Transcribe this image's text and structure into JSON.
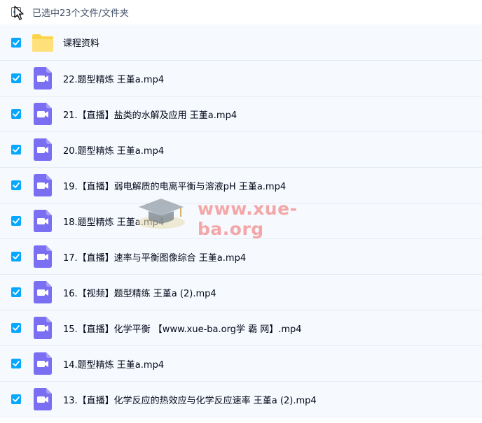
{
  "header": {
    "selection_text": "已选中23个文件/文件夹"
  },
  "colors": {
    "checkbox": "#06a7ff",
    "folder": "#fbd44b",
    "video_icon": "#7a6ef2",
    "row_bg": "#f6f9fd",
    "watermark": "#f38c8c"
  },
  "files": [
    {
      "name": "课程资料",
      "type": "folder-icon",
      "checked": true
    },
    {
      "name": "22.题型精炼 王堇a.mp4",
      "type": "video-file-icon",
      "checked": true
    },
    {
      "name": "21.【直播】盐类的水解及应用 王堇a.mp4",
      "type": "video-file-icon",
      "checked": true
    },
    {
      "name": "20.题型精炼 王堇a.mp4",
      "type": "video-file-icon",
      "checked": true
    },
    {
      "name": "19.【直播】弱电解质的电离平衡与溶液pH 王堇a.mp4",
      "type": "video-file-icon",
      "checked": true
    },
    {
      "name": "18.题型精炼 王堇a.mp4",
      "type": "video-file-icon",
      "checked": true
    },
    {
      "name": "17.【直播】速率与平衡图像综合 王堇a.mp4",
      "type": "video-file-icon",
      "checked": true
    },
    {
      "name": "16.【视频】题型精练 王堇a (2).mp4",
      "type": "video-file-icon",
      "checked": true
    },
    {
      "name": "15.【直播】化学平衡 【www.xue-ba.org学 霸 网】.mp4",
      "type": "video-file-icon",
      "checked": true
    },
    {
      "name": "14.题型精炼 王堇a.mp4",
      "type": "video-file-icon",
      "checked": true
    },
    {
      "name": "13.【直播】化学反应的热效应与化学反应速率 王堇a (2).mp4",
      "type": "video-file-icon",
      "checked": true
    }
  ],
  "watermark": {
    "text": "www.xue-ba.org"
  }
}
